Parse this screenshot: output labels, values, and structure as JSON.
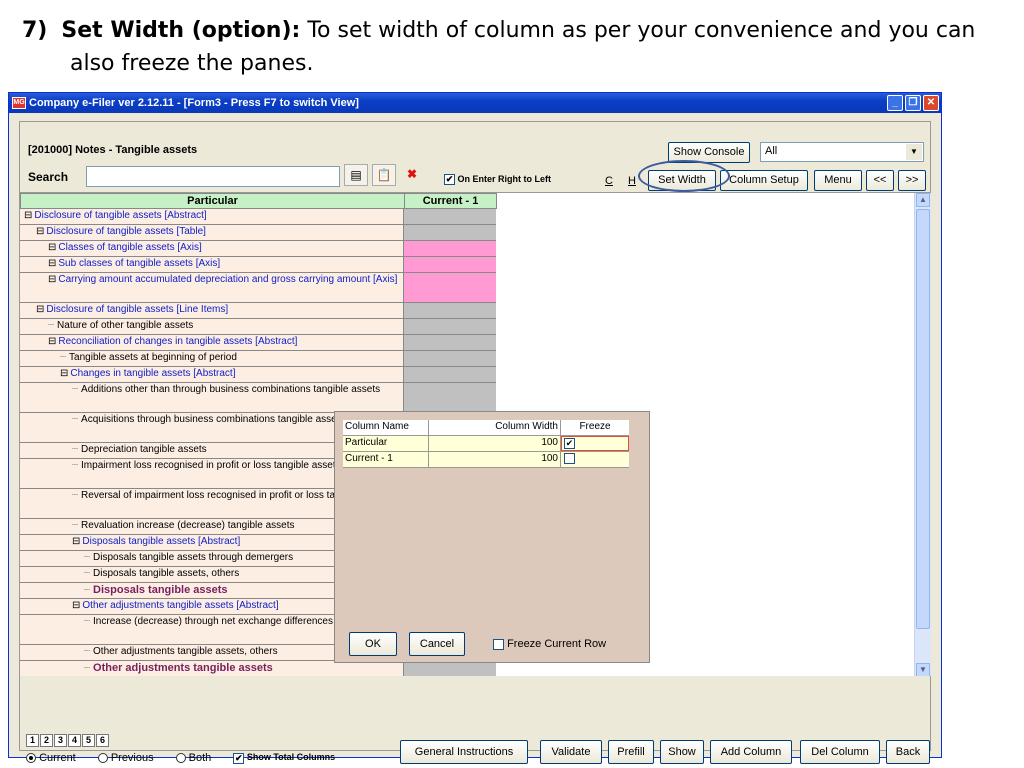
{
  "slide": {
    "number": "7)",
    "bold": "Set Width (option):",
    "rest_line1": "To set width of column as per your convenience and you can",
    "line2": "also freeze the panes."
  },
  "window": {
    "title": "Company e-Filer ver 2.12.11 - [Form3 - Press F7 to switch View]",
    "app_icon": "MG"
  },
  "header": {
    "section": "[201000] Notes - Tangible assets",
    "search_label": "Search",
    "search_value": "",
    "on_enter": "On Enter Right to Left",
    "show_console": "Show Console",
    "filter_value": "All"
  },
  "toolbar": {
    "c": "C",
    "h": "H",
    "set_width": "Set Width",
    "column_setup": "Column Setup",
    "menu": "Menu",
    "prev": "<<",
    "next": ">>"
  },
  "grid": {
    "headers": [
      "Particular",
      "Current - 1"
    ],
    "rows": [
      {
        "text": "Disclosure of tangible assets [Abstract]",
        "cls": "blue",
        "indent": 0,
        "exp": "⊟",
        "color": "#c0c0c0"
      },
      {
        "text": "Disclosure of tangible assets [Table]",
        "cls": "blue",
        "indent": 1,
        "exp": "⊟",
        "color": "#c0c0c0"
      },
      {
        "text": "Classes of tangible assets [Axis]",
        "cls": "blue",
        "indent": 2,
        "exp": "⊟",
        "color": "#ff9ad2"
      },
      {
        "text": "Sub classes of tangible assets [Axis]",
        "cls": "blue",
        "indent": 2,
        "exp": "⊟",
        "color": "#ff9ad2"
      },
      {
        "text": "Carrying amount accumulated depreciation and gross carrying amount [Axis]",
        "cls": "blue",
        "indent": 2,
        "exp": "⊟",
        "color": "#ff9ad2",
        "tall": true
      },
      {
        "text": "Disclosure of tangible assets [Line Items]",
        "cls": "blue",
        "indent": 1,
        "exp": "⊟",
        "color": "#c0c0c0"
      },
      {
        "text": "Nature of other tangible assets",
        "cls": "",
        "indent": 2,
        "exp": "",
        "color": "#c0c0c0"
      },
      {
        "text": "Reconciliation of changes in tangible assets [Abstract]",
        "cls": "blue",
        "indent": 2,
        "exp": "⊟",
        "color": "#c0c0c0"
      },
      {
        "text": "Tangible assets at beginning of period",
        "cls": "",
        "indent": 3,
        "exp": "",
        "color": "#c0c0c0"
      },
      {
        "text": "Changes in tangible assets [Abstract]",
        "cls": "blue",
        "indent": 3,
        "exp": "⊟",
        "color": "#c0c0c0"
      },
      {
        "text": "Additions other than through business combinations tangible assets",
        "cls": "",
        "indent": 4,
        "exp": "",
        "color": "#c0c0c0",
        "tall": true
      },
      {
        "text": "Acquisitions through business combinations tangible assets",
        "cls": "",
        "indent": 4,
        "exp": "",
        "color": "#c0c0c0",
        "tall": true
      },
      {
        "text": "Depreciation tangible assets",
        "cls": "",
        "indent": 4,
        "exp": "",
        "color": "#c0c0c0"
      },
      {
        "text": "Impairment loss recognised in profit or loss tangible assets",
        "cls": "",
        "indent": 4,
        "exp": "",
        "color": "#c0c0c0",
        "tall": true
      },
      {
        "text": "Reversal of impairment loss recognised in profit or loss tangible assets",
        "cls": "",
        "indent": 4,
        "exp": "",
        "color": "#c0c0c0",
        "tall": true
      },
      {
        "text": "Revaluation increase (decrease) tangible assets",
        "cls": "",
        "indent": 4,
        "exp": "",
        "color": "#c0c0c0"
      },
      {
        "text": "Disposals tangible assets [Abstract]",
        "cls": "blue",
        "indent": 4,
        "exp": "⊟",
        "color": "#c0c0c0"
      },
      {
        "text": "Disposals tangible assets through demergers",
        "cls": "",
        "indent": 5,
        "exp": "",
        "color": "#c8f4f8"
      },
      {
        "text": "Disposals tangible assets, others",
        "cls": "",
        "indent": 5,
        "exp": "",
        "color": "#c8f4f8"
      },
      {
        "text": "Disposals tangible assets",
        "cls": "purple",
        "indent": 5,
        "exp": "",
        "color": "#c0c0c0"
      },
      {
        "text": "Other adjustments tangible assets [Abstract]",
        "cls": "blue",
        "indent": 4,
        "exp": "⊟",
        "color": "#c0c0c0"
      },
      {
        "text": "Increase (decrease) through net exchange differences tangible assets",
        "cls": "",
        "indent": 5,
        "exp": "",
        "color": "#c8f4f8",
        "tall": true
      },
      {
        "text": "Other adjustments tangible assets, others",
        "cls": "",
        "indent": 5,
        "exp": "",
        "color": "#c8f4f8"
      },
      {
        "text": "Other adjustments tangible assets",
        "cls": "purple",
        "indent": 5,
        "exp": "",
        "color": "#c0c0c0"
      }
    ]
  },
  "dialog": {
    "headers": [
      "Column Name",
      "Column Width",
      "Freeze"
    ],
    "rows": [
      {
        "name": "Particular",
        "width": "100",
        "freeze": true
      },
      {
        "name": "Current - 1",
        "width": "100",
        "freeze": false
      }
    ],
    "ok": "OK",
    "cancel": "Cancel",
    "freeze_row": "Freeze Current Row"
  },
  "footer": {
    "tabs": [
      "1",
      "2",
      "3",
      "4",
      "5",
      "6"
    ],
    "radios": [
      "Current",
      "Previous",
      "Both"
    ],
    "show_total": "Show Total Columns",
    "buttons": [
      "General Instructions",
      "Validate",
      "Prefill",
      "Show",
      "Add Column",
      "Del Column",
      "Back"
    ]
  }
}
